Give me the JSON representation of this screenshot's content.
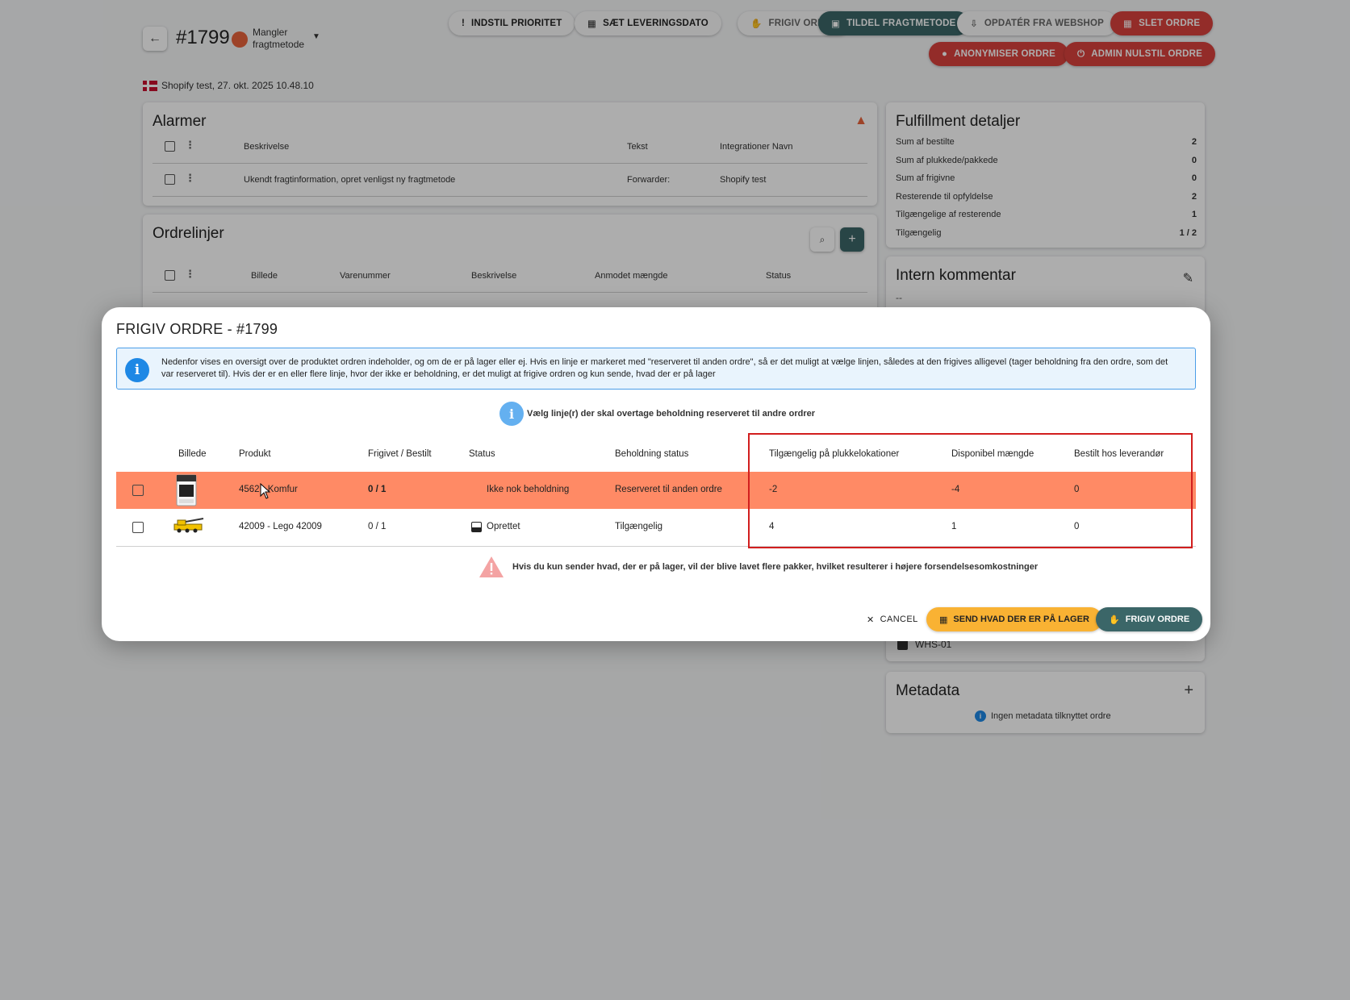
{
  "header": {
    "order_no": "#1799",
    "status": "Mangler fragtmetode",
    "shop_line": "Shopify test, 27. okt. 2025 10.48.10"
  },
  "toolbar": {
    "prioritet": "INDSTIL PRIORITET",
    "leveringsdato": "SÆT LEVERINGSDATO",
    "frigiv": "FRIGIV ORDRE",
    "tildel": "TILDEL FRAGTMETODE",
    "opdater": "OPDATÉR FRA WEBSHOP",
    "slet": "SLET ORDRE",
    "anonymiser": "ANONYMISER ORDRE",
    "nulstil": "ADMIN NULSTIL ORDRE"
  },
  "alarms": {
    "title": "Alarmer",
    "headers": [
      "Beskrivelse",
      "Tekst",
      "Integrationer Navn"
    ],
    "row": [
      "Ukendt fragtinformation, opret venligst ny fragtmetode",
      "Forwarder:",
      "Shopify test"
    ]
  },
  "orderlines": {
    "title": "Ordrelinjer",
    "headers": [
      "Billede",
      "Varenummer",
      "Beskrivelse",
      "Anmodet mængde",
      "Status"
    ]
  },
  "fulfillment": {
    "title": "Fulfillment detaljer",
    "rows": [
      {
        "label": "Sum af bestilte",
        "value": "2"
      },
      {
        "label": "Sum af plukkede/pakkede",
        "value": "0"
      },
      {
        "label": "Sum af frigivne",
        "value": "0"
      },
      {
        "label": "Resterende til opfyldelse",
        "value": "2"
      },
      {
        "label": "Tilgængelige af resterende",
        "value": "1"
      },
      {
        "label": "Tilgængelig",
        "value": "1 / 2"
      }
    ]
  },
  "comment": {
    "title": "Intern kommentar",
    "value": "--"
  },
  "warehouse": {
    "value": "WHS-01"
  },
  "metadata": {
    "title": "Metadata",
    "empty": "Ingen metadata tilknyttet ordre"
  },
  "modal": {
    "title": "FRIGIV ORDRE - #1799",
    "info": "Nedenfor vises en oversigt over de produktet ordren indeholder, og om de er på lager eller ej. Hvis en linje er markeret med \"reserveret til anden ordre\", så er det muligt at vælge linjen, således at den frigives alligevel (tager beholdning fra den ordre, som det var reserveret til). Hvis der er en eller flere linje, hvor der ikke er beholdning, er det muligt at frigive ordren og kun sende, hvad der er på lager",
    "hint": "Vælg linje(r) der skal overtage beholdning reserveret til andre ordrer",
    "columns": [
      "Billede",
      "Produkt",
      "Frigivet / Bestilt",
      "Status",
      "Beholdning status",
      "Tilgængelig på plukkelokationer",
      "Disponibel mængde",
      "Bestilt hos leverandør"
    ],
    "rows": [
      {
        "product": "4562 - Komfur",
        "released": "0 / 1",
        "status": "Ikke nok beholdning",
        "stock_status": "Reserveret til anden ordre",
        "available": "-2",
        "disposable": "-4",
        "supplier": "0"
      },
      {
        "product": "42009 - Lego 42009",
        "released": "0 / 1",
        "status": "Oprettet",
        "stock_status": "Tilgængelig",
        "available": "4",
        "disposable": "1",
        "supplier": "0"
      }
    ],
    "warning": "Hvis du kun sender hvad, der er på lager, vil der blive lavet flere pakker, hvilket resulterer i højere forsendelsesomkostninger",
    "cancel": "CANCEL",
    "send": "SEND HVAD DER ER PÅ LAGER",
    "frigiv": "FRIGIV ORDRE"
  },
  "colors": {
    "accent": "#3b6668",
    "danger": "#d9423d",
    "row_warning": "#ff8a65",
    "info": "#1e88e5",
    "send": "#f9b233"
  }
}
